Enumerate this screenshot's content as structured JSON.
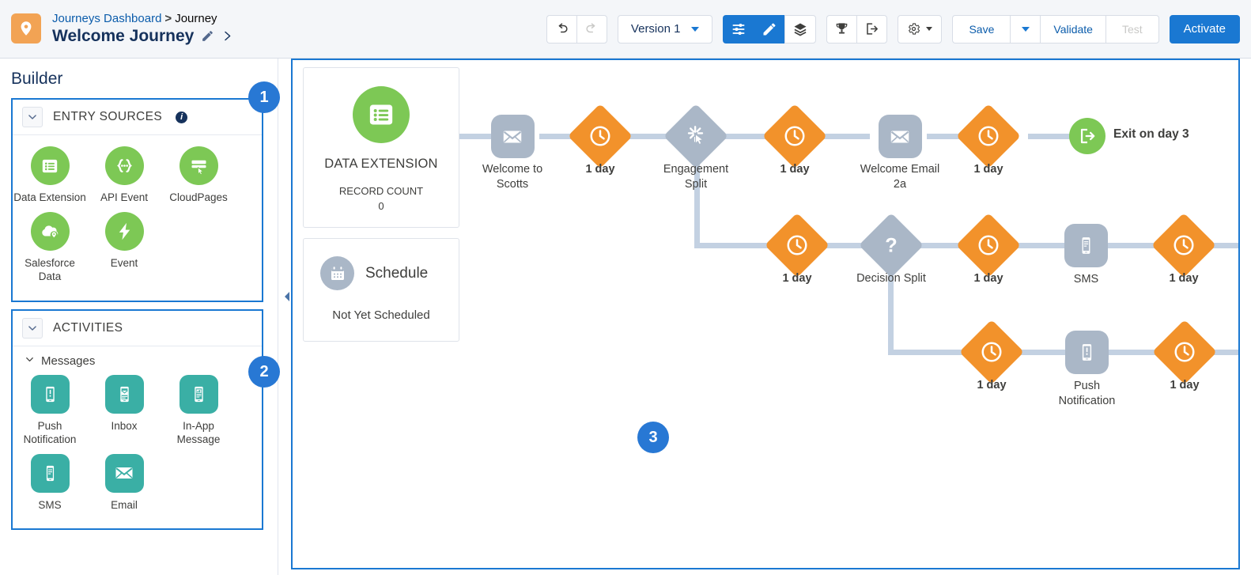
{
  "header": {
    "breadcrumb_link": "Journeys Dashboard",
    "breadcrumb_sep": ">",
    "breadcrumb_current": "Journey",
    "journey_name": "Welcome Journey",
    "edit_icon": "pencil-icon",
    "expand_icon": "chevron-right-icon",
    "brand_icon": "location-pin-icon"
  },
  "toolbar": {
    "undo_icon": "undo-icon",
    "redo_icon": "redo-icon",
    "version_label": "Version 1",
    "version_caret_icon": "chevron-down-icon",
    "view_settings_icon": "sliders-icon",
    "edit_mode_icon": "pencil-icon",
    "layers_icon": "layers-icon",
    "goals_icon": "trophy-icon",
    "exit_criteria_icon": "exit-icon",
    "gear_icon": "gear-icon",
    "gear_caret_icon": "caret-down-icon",
    "save_label": "Save",
    "save_caret_icon": "caret-down-icon",
    "validate_label": "Validate",
    "test_label": "Test",
    "test_disabled": true,
    "activate_label": "Activate",
    "accent_color": "#1a78d2"
  },
  "sidebar": {
    "title": "Builder",
    "entry_sources": {
      "header": "ENTRY SOURCES",
      "info_icon": "info-icon",
      "collapse_icon": "chevron-down-icon",
      "items": [
        {
          "label": "Data Extension",
          "icon": "list-icon",
          "color": "#7dc855"
        },
        {
          "label": "API Event",
          "icon": "braces-icon",
          "color": "#7dc855"
        },
        {
          "label": "CloudPages",
          "icon": "cloudpage-icon",
          "color": "#7dc855"
        },
        {
          "label": "Salesforce Data",
          "icon": "cloud-pin-icon",
          "color": "#7dc855"
        },
        {
          "label": "Event",
          "icon": "lightning-icon",
          "color": "#7dc855"
        }
      ]
    },
    "activities": {
      "header": "ACTIVITIES",
      "collapse_icon": "chevron-down-icon",
      "subgroup_label": "Messages",
      "subgroup_icon": "chevron-down-icon",
      "items": [
        {
          "label": "Push Notification",
          "icon": "push-notification-icon",
          "color": "#3aafa5"
        },
        {
          "label": "Inbox",
          "icon": "inbox-icon",
          "color": "#3aafa5"
        },
        {
          "label": "In-App Message",
          "icon": "in-app-message-icon",
          "color": "#3aafa5"
        },
        {
          "label": "SMS",
          "icon": "sms-icon",
          "color": "#3aafa5"
        },
        {
          "label": "Email",
          "icon": "email-icon",
          "color": "#3aafa5"
        }
      ]
    }
  },
  "badges": [
    {
      "number": "1",
      "target": "entry-sources-panel"
    },
    {
      "number": "2",
      "target": "activities-panel"
    },
    {
      "number": "3",
      "target": "canvas"
    }
  ],
  "canvas": {
    "collapse_icon": "collapse-left-icon",
    "entry_card": {
      "icon": "list-icon",
      "title": "DATA EXTENSION",
      "meta_label": "RECORD COUNT",
      "meta_value": "0"
    },
    "schedule_card": {
      "icon": "calendar-icon",
      "title": "Schedule",
      "status": "Not Yet Scheduled"
    },
    "rows": [
      {
        "nodes": [
          {
            "label": "Welcome to Scotts",
            "type": "email",
            "icon": "email-icon"
          },
          {
            "label": "1 day",
            "type": "wait",
            "icon": "clock-icon"
          },
          {
            "label": "Engagement Split",
            "type": "split",
            "icon": "engagement-split-icon"
          },
          {
            "label": "1 day",
            "type": "wait",
            "icon": "clock-icon"
          },
          {
            "label": "Welcome Email 2a",
            "type": "email",
            "icon": "email-icon"
          },
          {
            "label": "1 day",
            "type": "wait",
            "icon": "clock-icon"
          },
          {
            "label": "Exit on day 3",
            "type": "exit",
            "icon": "exit-icon"
          }
        ]
      },
      {
        "nodes": [
          {
            "label": "1 day",
            "type": "wait",
            "icon": "clock-icon"
          },
          {
            "label": "Decision Split",
            "type": "split",
            "icon": "question-mark-icon"
          },
          {
            "label": "1 day",
            "type": "wait",
            "icon": "clock-icon"
          },
          {
            "label": "SMS",
            "type": "sms",
            "icon": "sms-icon"
          },
          {
            "label": "1 day",
            "type": "wait",
            "icon": "clock-icon"
          }
        ]
      },
      {
        "nodes": [
          {
            "label": "1 day",
            "type": "wait",
            "icon": "clock-icon"
          },
          {
            "label": "Push Notification",
            "type": "push",
            "icon": "push-notification-icon"
          },
          {
            "label": "1 day",
            "type": "wait",
            "icon": "clock-icon"
          }
        ]
      }
    ]
  },
  "colors": {
    "wait_orange": "#f2922b",
    "grey_node": "#aab7c7",
    "green": "#7dc855",
    "teal": "#3aafa5",
    "wire": "#c3d1e2",
    "blue": "#1a78d2"
  }
}
